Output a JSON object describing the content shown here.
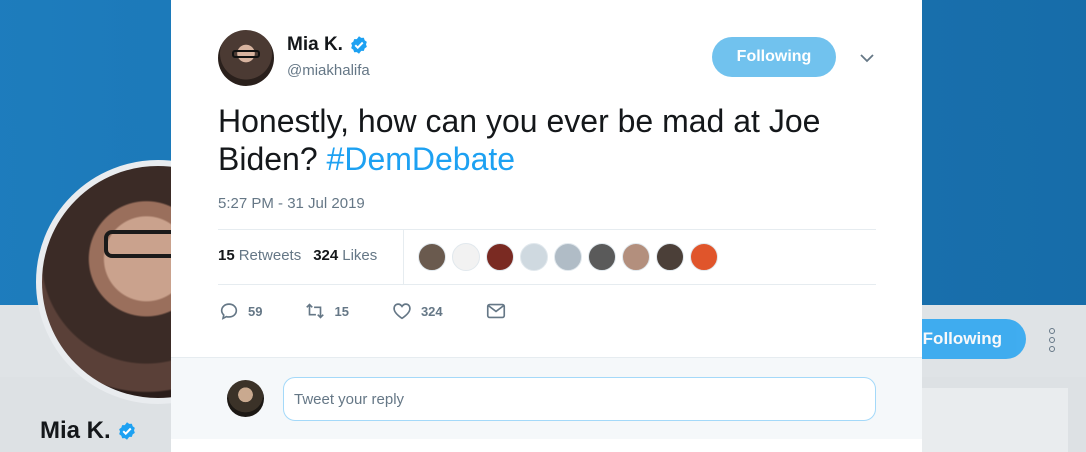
{
  "profile_page": {
    "name": "Mia K.",
    "follow_button_label": "Following"
  },
  "tweet": {
    "author_name": "Mia K.",
    "author_handle": "@miakhalifa",
    "follow_button_label": "Following",
    "text_main": "Honestly, how can you ever be mad at Joe Biden? ",
    "hashtag": "#DemDebate",
    "timestamp": "5:27 PM - 31 Jul 2019",
    "stats": {
      "retweets_count": "15",
      "retweets_label": "Retweets",
      "likes_count": "324",
      "likes_label": "Likes"
    },
    "likers": [
      {
        "color": "#6a5a4e"
      },
      {
        "color": "#f2f2f2"
      },
      {
        "color": "#7a2a22"
      },
      {
        "color": "#cfd9e0"
      },
      {
        "color": "#b0bcc6"
      },
      {
        "color": "#5a5a5a"
      },
      {
        "color": "#b38f7d"
      },
      {
        "color": "#4b3f38"
      },
      {
        "color": "#e0552b"
      }
    ],
    "actions": {
      "replies": "59",
      "retweets": "15",
      "likes": "324"
    },
    "icons": [
      "verified-icon",
      "chevron-down-icon",
      "reply-icon",
      "retweet-icon",
      "like-icon",
      "message-icon",
      "more-icon"
    ]
  },
  "reply": {
    "placeholder": "Tweet your reply"
  },
  "colors": {
    "accent": "#1da1f2",
    "follow_button": "#71c2ee",
    "banner": "#1b78b8"
  }
}
